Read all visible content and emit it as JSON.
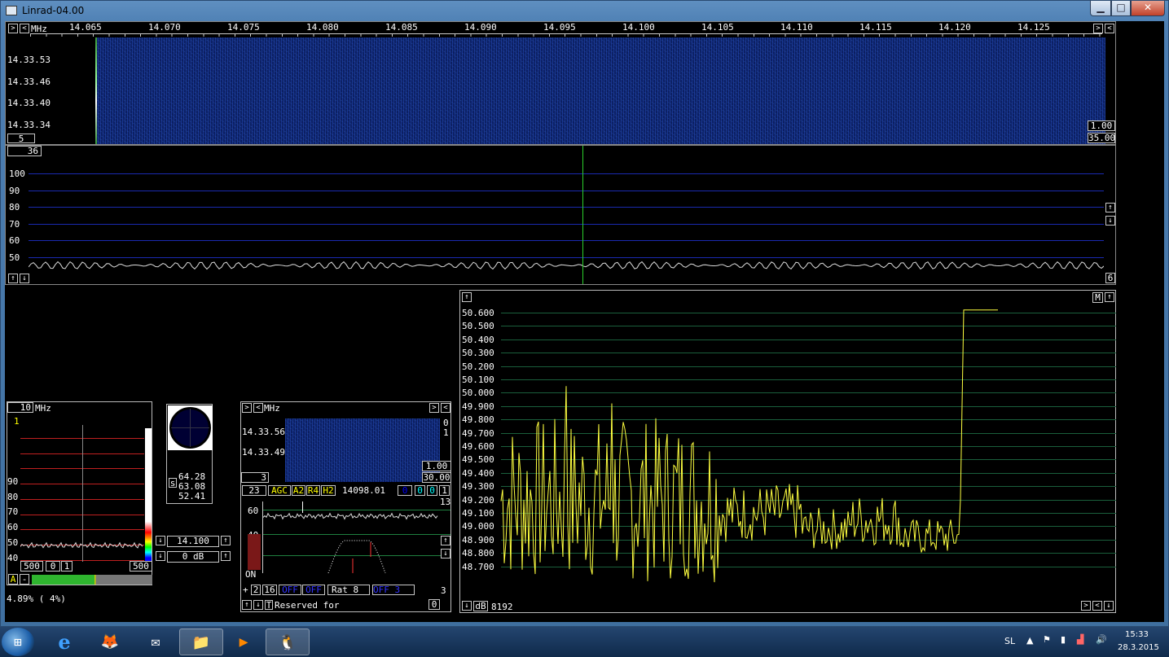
{
  "window": {
    "title": "Linrad-04.00",
    "min_glyph": "▁",
    "max_glyph": "□",
    "close_glyph": "✕"
  },
  "main_waterfall": {
    "unit": "MHz",
    "freq_ticks": [
      "14.065",
      "14.070",
      "14.075",
      "14.080",
      "14.085",
      "14.090",
      "14.095",
      "14.100",
      "14.105",
      "14.110",
      "14.115",
      "14.120",
      "14.125"
    ],
    "time_labels": [
      "14.33.53",
      "14.33.46",
      "14.33.40",
      "14.33.34"
    ],
    "left_box": "5",
    "right_box_top": "1.00",
    "right_box_bottom": "35.00"
  },
  "main_spectrum": {
    "top_box": "36",
    "db_labels": [
      "100",
      "90",
      "80",
      "70",
      "60",
      "50"
    ],
    "right_box": "6"
  },
  "s_meter": {
    "top_box": "10",
    "unit": "MHz",
    "marker": "1",
    "db_labels": [
      "90",
      "80",
      "70",
      "60",
      "50",
      "40"
    ],
    "bottom_boxes": [
      "500",
      "0",
      "1",
      "500"
    ],
    "a_button": "A",
    "dash_button": "-",
    "status": "4.89%  ( 4%)"
  },
  "scope": {
    "s_label": "s",
    "values": [
      "64.28",
      "63.08",
      "52.41"
    ]
  },
  "freq_control": {
    "frequency": "14.100",
    "gain": "0 dB"
  },
  "baseband": {
    "unit": "MHz",
    "time_labels": [
      "14.33.56",
      "14.33.49"
    ],
    "side_labels": [
      "0",
      "1"
    ],
    "left_box": "3",
    "right_box_top": "1.00",
    "right_box_bottom": "30.00",
    "controls": [
      "23",
      "AGC",
      "A2",
      "R4",
      "H2",
      "14098.01",
      "0",
      "0",
      "0",
      "1"
    ],
    "count": "13",
    "db_labels": [
      "60",
      "40",
      "20",
      "ON"
    ],
    "bottom_controls": [
      "+",
      "2",
      "16",
      "OFF",
      "OFF",
      "Rat",
      "8",
      "OFF",
      "3"
    ],
    "bottom_right": "3",
    "reserved_text": "Reserved for",
    "bottom_box_end": "0"
  },
  "s_graph": {
    "y_labels": [
      "50.600",
      "50.500",
      "50.400",
      "50.300",
      "50.200",
      "50.100",
      "50.000",
      "49.900",
      "49.800",
      "49.700",
      "49.600",
      "49.500",
      "49.400",
      "49.300",
      "49.200",
      "49.100",
      "49.000",
      "48.900",
      "48.800",
      "48.700"
    ],
    "db_label": "dB",
    "points_label": "8192",
    "m_button": "M"
  },
  "taskbar": {
    "apps": [
      "e",
      "🦊",
      "✉",
      "📁",
      "▶",
      "🐧"
    ],
    "language": "SL",
    "time": "15:33",
    "date": "28.3.2015"
  },
  "colors": {
    "trace_yellow": "#ffff40",
    "grid_green": "#1f5f3f",
    "grid_blue": "#1a2ab0",
    "wf_blue": "#0d2566"
  }
}
